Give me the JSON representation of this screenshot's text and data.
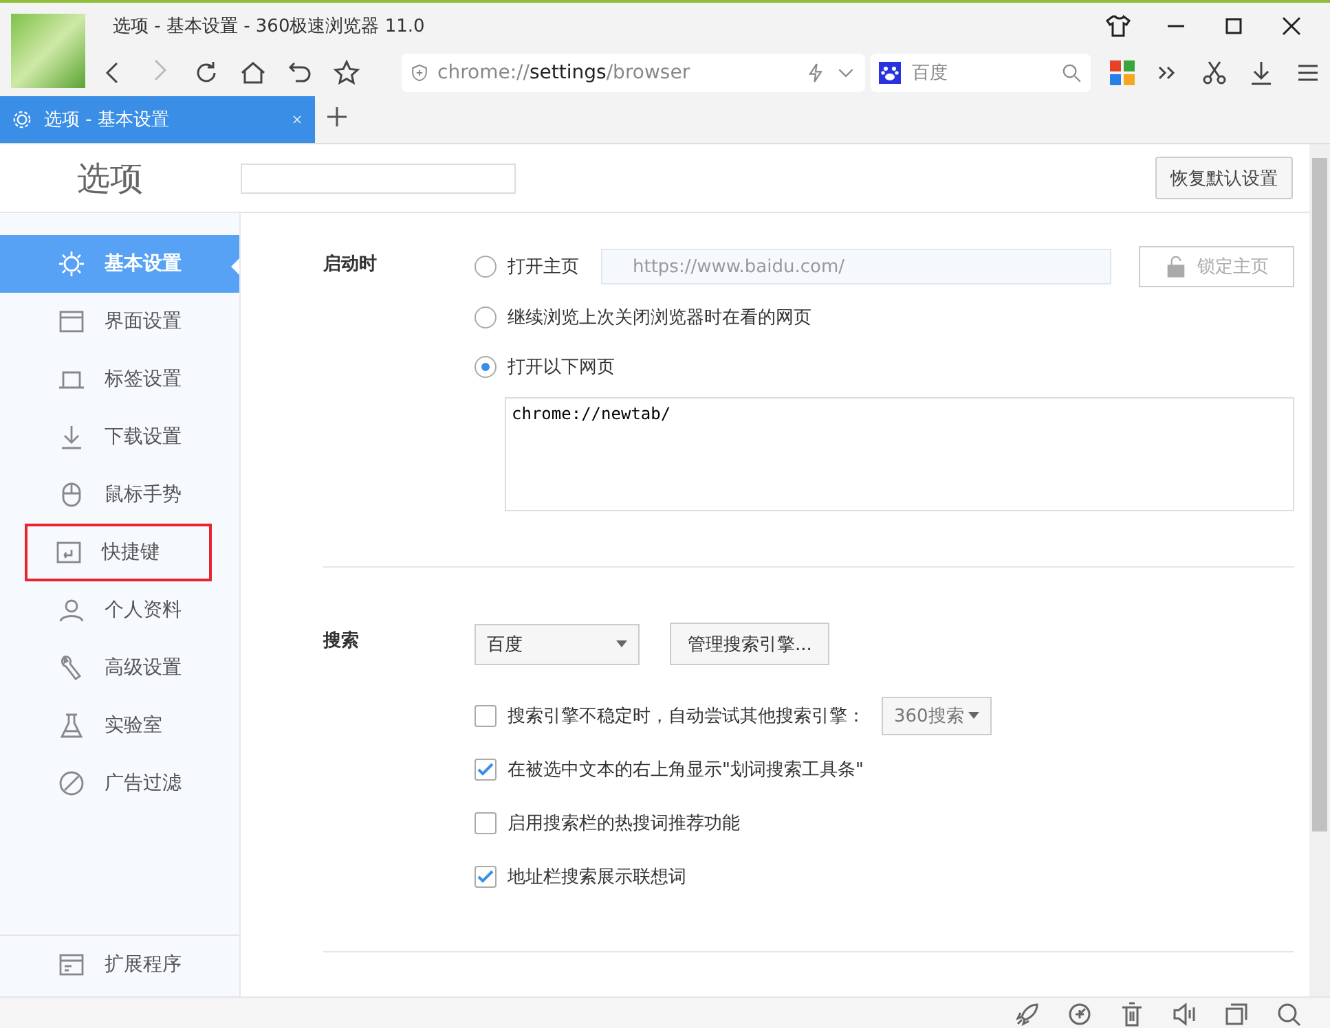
{
  "window": {
    "title": "选项 - 基本设置 - 360极速浏览器 11.0"
  },
  "address_bar": {
    "url": "chrome://**settings**/browser"
  },
  "search_box": {
    "placeholder": "百度"
  },
  "tabs": [
    {
      "label": "选项 - 基本设置",
      "selected": true
    }
  ],
  "header": {
    "title": "选项",
    "restore_button": "恢复默认设置"
  },
  "sidebar": {
    "items": [
      {
        "label": "基本设置",
        "selected": true,
        "highlighted": false
      },
      {
        "label": "界面设置",
        "selected": false,
        "highlighted": false
      },
      {
        "label": "标签设置",
        "selected": false,
        "highlighted": false
      },
      {
        "label": "下载设置",
        "selected": false,
        "highlighted": false
      },
      {
        "label": "鼠标手势",
        "selected": false,
        "highlighted": false
      },
      {
        "label": "快捷键",
        "selected": false,
        "highlighted": true
      },
      {
        "label": "个人资料",
        "selected": false,
        "highlighted": false
      },
      {
        "label": "高级设置",
        "selected": false,
        "highlighted": false
      },
      {
        "label": "实验室",
        "selected": false,
        "highlighted": false
      },
      {
        "label": "广告过滤",
        "selected": false,
        "highlighted": false
      }
    ],
    "footer_item": {
      "label": "扩展程序"
    }
  },
  "startup": {
    "label": "启动时",
    "options": [
      {
        "label": "打开主页",
        "selected": false,
        "homepage": "https://www.baidu.com/",
        "lock_button": {
          "label": "锁定主页",
          "disabled": true
        }
      },
      {
        "label": "继续浏览上次关闭浏览器时在看的网页",
        "selected": false
      },
      {
        "label": "打开以下网页",
        "selected": true,
        "pages": "chrome://newtab/"
      }
    ]
  },
  "search": {
    "label": "搜索",
    "engine": "百度",
    "manage_button": "管理搜索引擎...",
    "options": [
      {
        "label": "搜索引擎不稳定时，自动尝试其他搜索引擎：",
        "checked": false,
        "fallback": "360搜索"
      },
      {
        "label": "在被选中文本的右上角显示\"划词搜索工具条\"",
        "checked": true
      },
      {
        "label": "启用搜索栏的热搜词推荐功能",
        "checked": false
      },
      {
        "label": "地址栏搜索展示联想词",
        "checked": true
      }
    ]
  }
}
